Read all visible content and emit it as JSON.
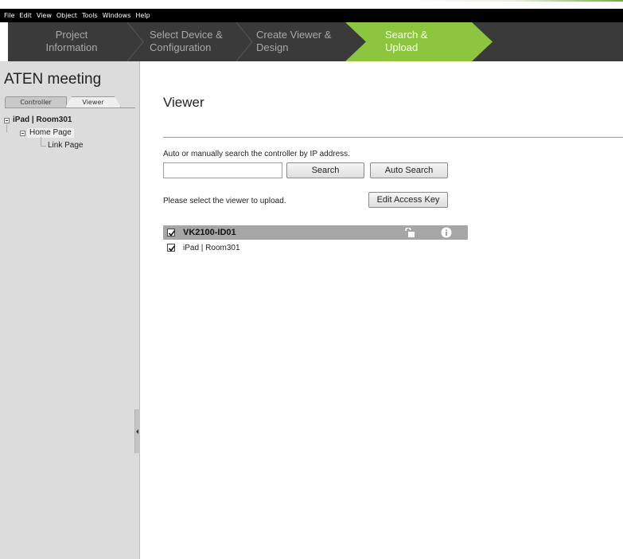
{
  "menu": [
    "File",
    "Edit",
    "View",
    "Object",
    "Tools",
    "Windows",
    "Help"
  ],
  "steps": [
    {
      "line1": "Project",
      "line2": "Information"
    },
    {
      "line1": "Select Device &",
      "line2": "Configuration"
    },
    {
      "line1": "Create Viewer &",
      "line2": "Design"
    },
    {
      "line1": "Search &",
      "line2": "Upload"
    }
  ],
  "active_step_color": "#8cc63f",
  "sidebar": {
    "title": "ATEN meeting",
    "tabs": [
      "Controller",
      "Viewer"
    ],
    "tree": {
      "root": "iPad | Room301",
      "home": "Home Page",
      "link": "Link Page"
    }
  },
  "main": {
    "title": "Viewer",
    "instructions": "Auto or manually search the controller by IP address.",
    "ip_value": "",
    "search_label": "Search",
    "auto_search_label": "Auto Search",
    "select_text": "Please select the viewer to upload.",
    "edit_key_label": "Edit Access Key",
    "device": {
      "name": "VK2100-ID01",
      "checked": true,
      "icons": [
        "unlock-icon",
        "info-icon"
      ]
    },
    "viewer": {
      "name": "iPad | Room301",
      "checked": true
    }
  }
}
